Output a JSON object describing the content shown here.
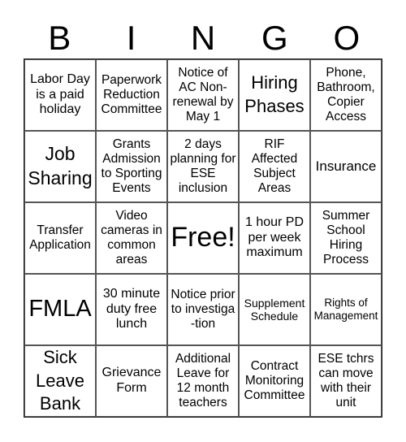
{
  "header": {
    "letters": [
      "B",
      "I",
      "N",
      "G",
      "O"
    ]
  },
  "cells": [
    "Labor Day is a paid holiday",
    "Paperwork Reduction Committee",
    "Notice of AC Non-renewal by May 1",
    "Hiring Phases",
    "Phone, Bathroom, Copier Access",
    "Job Sharing",
    "Grants Admission to Sporting Events",
    "2 days planning for ESE inclusion",
    "RIF Affected Subject Areas",
    "Insurance",
    "Transfer Application",
    "Video cameras in common areas",
    "Free!",
    "1 hour PD per week maximum",
    "Summer School Hiring Process",
    "FMLA",
    "30 minute duty free lunch",
    "Notice prior to investiga -tion",
    "Supplement Schedule",
    "Rights of Management",
    "Sick Leave Bank",
    "Grievance Form",
    "Additional Leave for 12 month teachers",
    "Contract Monitoring Committee",
    "ESE tchrs can move with their unit"
  ]
}
